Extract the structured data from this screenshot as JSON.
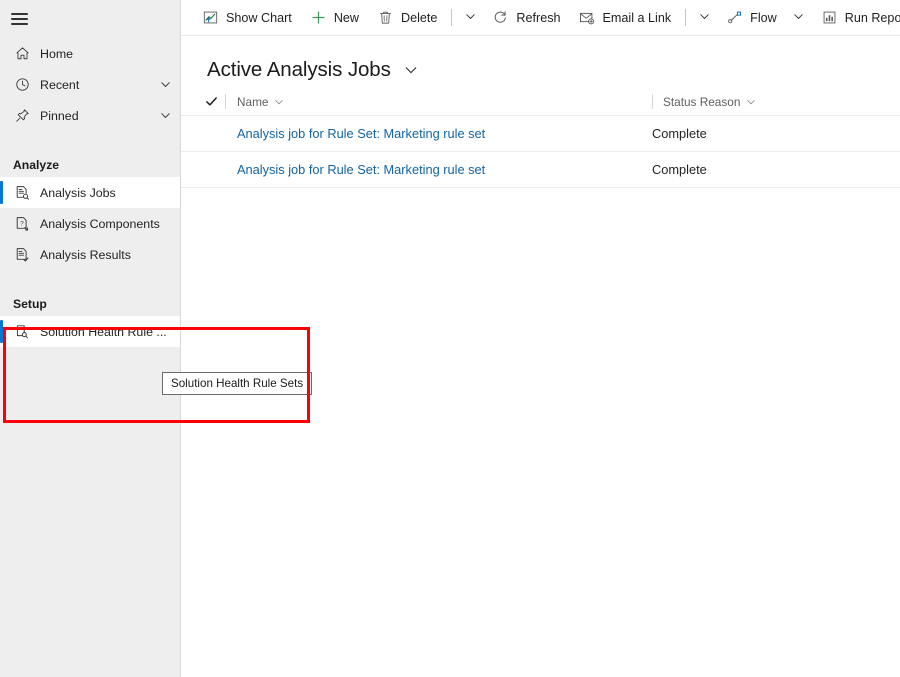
{
  "sidebar": {
    "menu_icon": "hamburger-icon",
    "top_items": [
      {
        "label": "Home",
        "icon": "home-icon",
        "has_chevron": false
      },
      {
        "label": "Recent",
        "icon": "clock-icon",
        "has_chevron": true
      },
      {
        "label": "Pinned",
        "icon": "pin-icon",
        "has_chevron": true
      }
    ],
    "groups": [
      {
        "title": "Analyze",
        "items": [
          {
            "label": "Analysis Jobs",
            "icon": "document-search-icon",
            "selected": true
          },
          {
            "label": "Analysis Components",
            "icon": "document-question-icon",
            "selected": false
          },
          {
            "label": "Analysis Results",
            "icon": "document-check-icon",
            "selected": false
          }
        ]
      },
      {
        "title": "Setup",
        "items": [
          {
            "label": "Solution Health Rule ...",
            "icon": "document-magnifier-icon",
            "selected": true
          }
        ]
      }
    ],
    "accent_color": "#0078d4",
    "background_color": "#eeeeee"
  },
  "toolbar": {
    "commands": [
      {
        "label": "Show Chart",
        "icon": "chart-icon"
      },
      {
        "label": "New",
        "icon": "plus-icon"
      },
      {
        "label": "Delete",
        "icon": "trash-icon"
      },
      {
        "label": "Refresh",
        "icon": "refresh-icon"
      },
      {
        "label": "Email a Link",
        "icon": "email-link-icon"
      },
      {
        "label": "Flow",
        "icon": "flow-icon"
      },
      {
        "label": "Run Report",
        "icon": "report-icon"
      }
    ]
  },
  "view": {
    "title": "Active Analysis Jobs",
    "selector_icon": "chevron-down-icon"
  },
  "grid": {
    "select_all_icon": "checkmark-icon",
    "columns": [
      {
        "label": "Name"
      },
      {
        "label": "Status Reason"
      }
    ],
    "rows": [
      {
        "name": "Analysis job for Rule Set: Marketing rule set",
        "status_reason": "Complete"
      },
      {
        "name": "Analysis job for Rule Set: Marketing rule set",
        "status_reason": "Complete"
      }
    ],
    "link_color": "#1264a3"
  },
  "tooltip": {
    "text": "Solution Health Rule Sets"
  },
  "highlight": {
    "color": "#fb0007"
  }
}
